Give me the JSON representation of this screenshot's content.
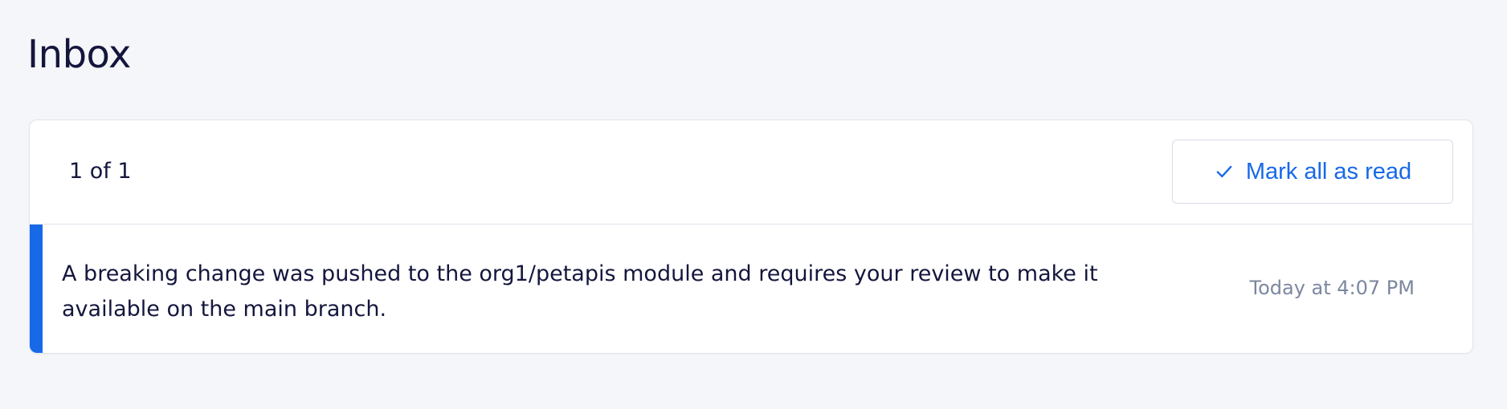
{
  "page": {
    "title": "Inbox"
  },
  "inbox": {
    "counter": "1 of 1",
    "mark_all_read_label": "Mark all as read",
    "mark_all_read_icon": "check-icon",
    "notifications": [
      {
        "message": "A breaking change was pushed to the org1/petapis module and requires your review to make it available on the main branch.",
        "timestamp": "Today at 4:07 PM",
        "unread": true
      }
    ]
  },
  "colors": {
    "background": "#f5f6fa",
    "accent": "#1769e8",
    "text": "#14163d",
    "muted_text": "#7c879f",
    "border": "#e1e4ec"
  }
}
